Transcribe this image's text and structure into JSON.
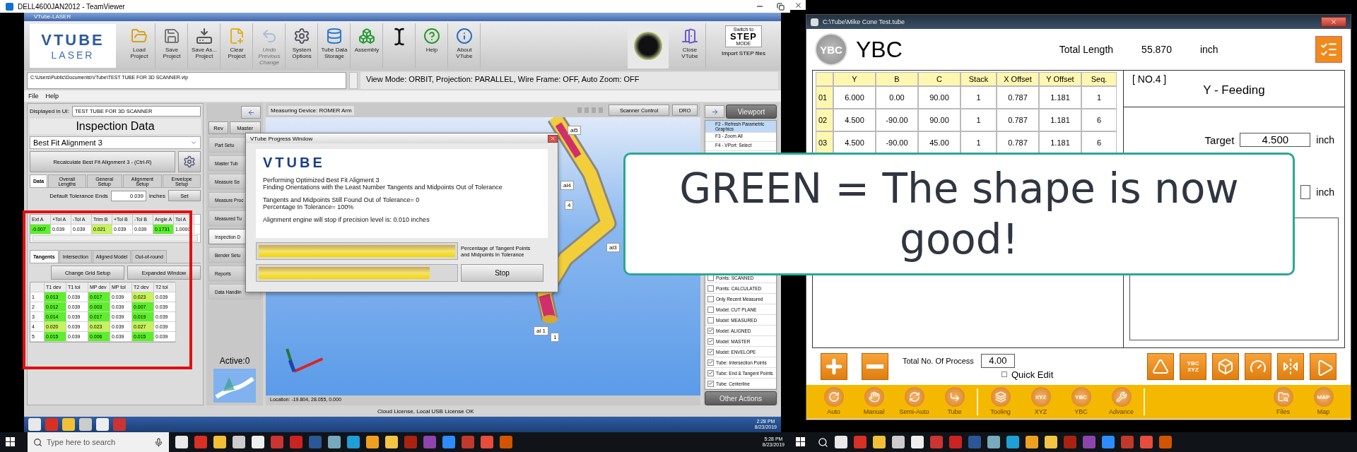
{
  "teamviewer": {
    "title": "DELL4600JAN2012 - TeamViewer"
  },
  "vtube": {
    "title": "VTube-LASER",
    "logo": [
      "VTUBE",
      "LASER"
    ],
    "toolbar": [
      {
        "kind": "tool",
        "label": "Load Project",
        "disabled": false
      },
      {
        "kind": "tool",
        "label": "Save Project",
        "disabled": false
      },
      {
        "kind": "tool",
        "label": "Save As... Project",
        "disabled": false
      },
      {
        "kind": "tool",
        "label": "Clear Project",
        "disabled": false
      },
      {
        "kind": "tool",
        "label": "Undo Previous Change",
        "disabled": true
      },
      {
        "kind": "tool",
        "label": "System Options",
        "disabled": false
      },
      {
        "kind": "tool",
        "label": "Tube Data Storage",
        "disabled": false
      },
      {
        "kind": "tool",
        "label": "Assembly",
        "disabled": false
      },
      {
        "kind": "cursor"
      },
      {
        "kind": "tool",
        "label": "Help",
        "disabled": false
      },
      {
        "kind": "tool",
        "label": "About VTube",
        "disabled": false
      }
    ],
    "close_label": "Close VTube",
    "step": {
      "badge": [
        "Switch to",
        "STEP",
        "MODE"
      ],
      "label": "Import STEP files"
    },
    "path": "C:\\Users\\Public\\Documents\\VTube\\TEST TUBE FOR 3D SCANNER.vtp",
    "view_mode": "View Mode: ORBIT, Projection: PARALLEL, Wire Frame: OFF, Auto Zoom: OFF",
    "menu": [
      "File",
      "Help"
    ],
    "inspection": {
      "displayed_label": "Displayed in UI:",
      "displayed_value": "TEST TUBE FOR 3D SCANNER",
      "title": "Inspection Data",
      "alignment": "Best Fit Alignment 3",
      "recalc": "Recalculate Best Fit Alignment 3 - (Ctrl-R)",
      "tabs": [
        {
          "label": "Data",
          "selected": true
        },
        {
          "label": "Overall Lengths",
          "selected": false
        },
        {
          "label": "General Setup",
          "selected": false
        },
        {
          "label": "Alignment Setup",
          "selected": false
        },
        {
          "label": "Envelope Setup",
          "selected": false
        }
      ],
      "tolerance": {
        "label": "Default Tolerance Ends",
        "value": "0.039",
        "unit": "inches",
        "button": "Set"
      },
      "data_table": {
        "columns": [
          "Ext A",
          "+Tol A",
          "-Tol A",
          "Trim B",
          "+Tol B",
          "-Tol B",
          "Angle A",
          "Tol A"
        ],
        "row": [
          {
            "text": "-0.007",
            "color": "#5cf02a"
          },
          {
            "text": "0.039"
          },
          {
            "text": "0.039"
          },
          {
            "text": "0.021",
            "color": "#c6f25a"
          },
          {
            "text": "0.039"
          },
          {
            "text": "0.039"
          },
          {
            "text": "0.1731",
            "color": "#5cf02a"
          },
          {
            "text": "1.0000"
          }
        ]
      },
      "subtabs": [
        {
          "label": "Tangents",
          "selected": true
        },
        {
          "label": "Intersection",
          "selected": false
        },
        {
          "label": "Aligned Model",
          "selected": false
        },
        {
          "label": "Out-of-round",
          "selected": false
        }
      ],
      "buttons": [
        "Change Grid Setup",
        "Expanded Window"
      ],
      "grid": {
        "columns": [
          "T1 dev",
          "T1 tol",
          "MP dev",
          "MP tol",
          "T2 dev",
          "T2 tol"
        ],
        "rows": [
          {
            "label": "1",
            "cells": [
              {
                "text": "0.013",
                "color": "#5cf02a"
              },
              {
                "text": "0.039"
              },
              {
                "text": "0.017",
                "color": "#5cf02a"
              },
              {
                "text": "0.039"
              },
              {
                "text": "0.023",
                "color": "#c6f25a"
              },
              {
                "text": "0.039"
              }
            ]
          },
          {
            "label": "2",
            "cells": [
              {
                "text": "0.012",
                "color": "#5cf02a"
              },
              {
                "text": "0.039"
              },
              {
                "text": "0.003",
                "color": "#5cf02a"
              },
              {
                "text": "0.039"
              },
              {
                "text": "0.007",
                "color": "#5cf02a"
              },
              {
                "text": "0.039"
              }
            ]
          },
          {
            "label": "3",
            "cells": [
              {
                "text": "0.014",
                "color": "#5cf02a"
              },
              {
                "text": "0.039"
              },
              {
                "text": "0.017",
                "color": "#5cf02a"
              },
              {
                "text": "0.039"
              },
              {
                "text": "0.019",
                "color": "#5cf02a"
              },
              {
                "text": "0.039"
              }
            ]
          },
          {
            "label": "4",
            "cells": [
              {
                "text": "0.020",
                "color": "#c6f25a"
              },
              {
                "text": "0.039"
              },
              {
                "text": "0.023",
                "color": "#c6f25a"
              },
              {
                "text": "0.039"
              },
              {
                "text": "0.027",
                "color": "#c6f25a"
              },
              {
                "text": "0.039"
              }
            ]
          },
          {
            "label": "5",
            "cells": [
              {
                "text": "0.015",
                "color": "#5cf02a"
              },
              {
                "text": "0.039"
              },
              {
                "text": "0.006",
                "color": "#5cf02a"
              },
              {
                "text": "0.039"
              },
              {
                "text": "0.015",
                "color": "#5cf02a"
              },
              {
                "text": "0.039"
              }
            ]
          }
        ]
      }
    },
    "nav": {
      "rev": "Rev",
      "master": "Master",
      "items": [
        {
          "label": "Part Setu",
          "selected": false
        },
        {
          "label": "Master Tub",
          "selected": false
        },
        {
          "label": "Measure Se",
          "selected": false
        },
        {
          "label": "Measure Proc",
          "selected": false
        },
        {
          "label": "Measured Tu",
          "selected": false
        },
        {
          "label": "Inspection D",
          "selected": true
        },
        {
          "label": "Bender Setu",
          "selected": false
        },
        {
          "label": "Reports",
          "selected": false
        },
        {
          "label": "Data Handlin",
          "selected": false
        }
      ],
      "active": "Active:0"
    },
    "viewport": {
      "device": "Measuring Device: ROMER Arm",
      "buttons": [
        "Scanner Control",
        "DRO"
      ],
      "labels": [
        "al5",
        "al4",
        "4",
        "al3",
        "al 1",
        "1"
      ],
      "location": "Location: -19.804, 28.055, 0.000"
    },
    "side": {
      "title": "Viewport",
      "shortcuts": [
        {
          "label": "F2 - Refresh Parametric Graphics",
          "selected": true
        },
        {
          "label": "F3 - Zoom All",
          "selected": false
        },
        {
          "label": "F4 - VPort: Select",
          "selected": false
        }
      ],
      "options": [
        {
          "label": "Points: SCANNED",
          "checked": false
        },
        {
          "label": "Points: CALCULATED",
          "checked": false
        },
        {
          "label": "Only Recent Measured",
          "checked": false
        },
        {
          "label": "Model: CUT PLANE",
          "checked": false
        },
        {
          "label": "Model: MEASURED",
          "checked": false
        },
        {
          "label": "Model: ALIGNED",
          "checked": true
        },
        {
          "label": "Model: MASTER",
          "checked": true
        },
        {
          "label": "Model: ENVELOPE",
          "checked": true
        },
        {
          "label": "Tube: Intersection Points",
          "checked": true
        },
        {
          "label": "Tube: End & Tangent Points",
          "checked": true
        },
        {
          "label": "Tube: Centerline",
          "checked": true
        }
      ],
      "other_actions": "Other Actions"
    },
    "status": "Cloud License, Local USB License OK",
    "progress": {
      "title": "VTube Progress Window",
      "logo": "VTUBE",
      "paragraphs": [
        [
          "Performing Optimized Best Fit Aligment 3",
          "Finding Orientations with the Least Number Tangents and Midpoints Out of Tolerance"
        ],
        [
          "Tangents and Midpoints Still Found Out of Tolerance= 0",
          "Percentage In Tolerance= 100%"
        ],
        [
          "Alignment engine will stop if precision level is: 0.010 inches"
        ]
      ],
      "bars": [
        {
          "level": 1
        },
        {
          "level": 0.87
        }
      ],
      "bar_label": "Percentage of Tangent Points and Midpoints In Tolerance",
      "stop": "Stop"
    },
    "remote_tray": {
      "time": "2:28 PM",
      "date": "8/23/2019"
    }
  },
  "taskbar": {
    "search": "Type here to search",
    "time": "5:28 PM",
    "date": "8/23/2019"
  },
  "ybc": {
    "title": "C:\\Tube\\Mike Cone Test.tube",
    "logo": "YBC",
    "heading": "YBC",
    "total_label": "Total Length",
    "total_value": "55.870",
    "total_unit": "inch",
    "columns": [
      "Y",
      "B",
      "C",
      "Stack",
      "X Offset",
      "Y Offset",
      "Seq."
    ],
    "rows": [
      {
        "label": "01",
        "cells": [
          "6.000",
          "0.00",
          "90.00",
          "1",
          "0.787",
          "1.181",
          "1"
        ]
      },
      {
        "label": "02",
        "cells": [
          "4.500",
          "-90.00",
          "90.00",
          "1",
          "0.787",
          "1.181",
          "6"
        ]
      },
      {
        "label": "03",
        "cells": [
          "4.500",
          "-90.00",
          "45.00",
          "1",
          "0.787",
          "1.181",
          "6"
        ]
      }
    ],
    "step": "[ NO.4 ]",
    "step_name": "Y  - Feeding",
    "target_label": "Target",
    "target_value": "4.500",
    "target_unit": "inch",
    "second_unit": "inch",
    "process_label": "Total No. Of Process",
    "process_value": "4.00",
    "quick_edit": {
      "label": "Quick Edit",
      "checked": false
    },
    "convert": [
      "YBC",
      "XYZ"
    ],
    "nav": [
      {
        "label": "Auto"
      },
      {
        "label": "Manual"
      },
      {
        "label": "Semi-Auto"
      },
      {
        "label": "Tube"
      },
      {
        "label": "Tooling"
      },
      {
        "label": "XYZ",
        "glyph": "XYZ"
      },
      {
        "label": "YBC",
        "glyph": "YBC"
      },
      {
        "label": "Advance"
      }
    ],
    "nav_right": [
      {
        "label": "Files"
      },
      {
        "label": "Map",
        "glyph": "MAP"
      }
    ]
  },
  "callout": "GREEN = The shape is now good!"
}
